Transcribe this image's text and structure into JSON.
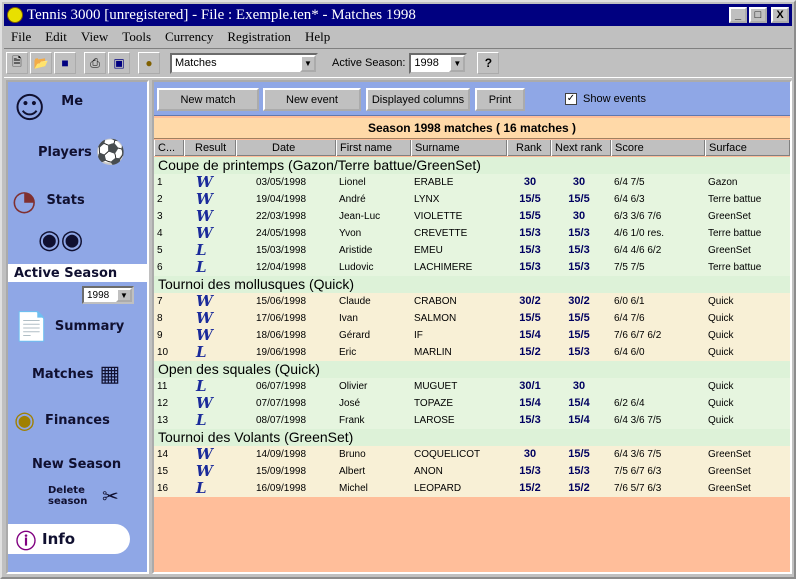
{
  "window": {
    "title": "Tennis 3000 [unregistered] - File : Exemple.ten* - Matches 1998",
    "buttons": [
      "_",
      "□",
      "X"
    ]
  },
  "menu": [
    "File",
    "Edit",
    "View",
    "Tools",
    "Currency",
    "Registration",
    "Help"
  ],
  "toolbar": {
    "view_select": "Matches",
    "season_label": "Active Season:",
    "season_select": "1998",
    "help_button": "?"
  },
  "sidebar": {
    "items": [
      "Me",
      "Players",
      "Stats",
      "Active Season",
      "Summary",
      "Matches",
      "Finances",
      "New Season",
      "Delete season",
      "Info"
    ],
    "season_select": "1998"
  },
  "actions": {
    "new_match": "New match",
    "new_event": "New event",
    "displayed_columns": "Displayed columns",
    "print": "Print",
    "show_events": "Show events",
    "show_events_checked": true
  },
  "season_header": "Season 1998 matches   ( 16 matches )",
  "columns": [
    "C...",
    "Result",
    "Date",
    "First name",
    "Surname",
    "Rank",
    "Next rank",
    "Score",
    "Surface"
  ],
  "groups": [
    {
      "title": "Coupe de printemps  (Gazon/Terre battue/GreenSet)",
      "bg": "green",
      "rows": [
        {
          "n": "1",
          "res": "W",
          "date": "03/05/1998",
          "first": "Lionel",
          "sur": "ERABLE",
          "rank": "30",
          "next": "30",
          "score": "6/4 7/5",
          "surface": "Gazon"
        },
        {
          "n": "2",
          "res": "W",
          "date": "19/04/1998",
          "first": "André",
          "sur": "LYNX",
          "rank": "15/5",
          "next": "15/5",
          "score": "6/4 6/3",
          "surface": "Terre battue"
        },
        {
          "n": "3",
          "res": "W",
          "date": "22/03/1998",
          "first": "Jean-Luc",
          "sur": "VIOLETTE",
          "rank": "15/5",
          "next": "30",
          "score": "6/3 3/6 7/6",
          "surface": "GreenSet"
        },
        {
          "n": "4",
          "res": "W",
          "date": "24/05/1998",
          "first": "Yvon",
          "sur": "CREVETTE",
          "rank": "15/3",
          "next": "15/3",
          "score": "4/6 1/0 res.",
          "surface": "Terre battue"
        },
        {
          "n": "5",
          "res": "L",
          "date": "15/03/1998",
          "first": "Aristide",
          "sur": "EMEU",
          "rank": "15/3",
          "next": "15/3",
          "score": "6/4 4/6 6/2",
          "surface": "GreenSet"
        },
        {
          "n": "6",
          "res": "L",
          "date": "12/04/1998",
          "first": "Ludovic",
          "sur": "LACHIMERE",
          "rank": "15/3",
          "next": "15/3",
          "score": "7/5 7/5",
          "surface": "Terre battue"
        }
      ]
    },
    {
      "title": "Tournoi des mollusques  (Quick)",
      "bg": "tan",
      "rows": [
        {
          "n": "7",
          "res": "W",
          "date": "15/06/1998",
          "first": "Claude",
          "sur": "CRABON",
          "rank": "30/2",
          "next": "30/2",
          "score": "6/0 6/1",
          "surface": "Quick"
        },
        {
          "n": "8",
          "res": "W",
          "date": "17/06/1998",
          "first": "Ivan",
          "sur": "SALMON",
          "rank": "15/5",
          "next": "15/5",
          "score": "6/4 7/6",
          "surface": "Quick"
        },
        {
          "n": "9",
          "res": "W",
          "date": "18/06/1998",
          "first": "Gérard",
          "sur": "IF",
          "rank": "15/4",
          "next": "15/5",
          "score": "7/6 6/7 6/2",
          "surface": "Quick"
        },
        {
          "n": "10",
          "res": "L",
          "date": "19/06/1998",
          "first": "Eric",
          "sur": "MARLIN",
          "rank": "15/2",
          "next": "15/3",
          "score": "6/4 6/0",
          "surface": "Quick"
        }
      ]
    },
    {
      "title": "Open des squales  (Quick)",
      "bg": "green",
      "rows": [
        {
          "n": "11",
          "res": "L",
          "date": "06/07/1998",
          "first": "Olivier",
          "sur": "MUGUET",
          "rank": "30/1",
          "next": "30",
          "score": "",
          "surface": "Quick"
        },
        {
          "n": "12",
          "res": "W",
          "date": "07/07/1998",
          "first": "José",
          "sur": "TOPAZE",
          "rank": "15/4",
          "next": "15/4",
          "score": "6/2 6/4",
          "surface": "Quick"
        },
        {
          "n": "13",
          "res": "L",
          "date": "08/07/1998",
          "first": "Frank",
          "sur": "LAROSE",
          "rank": "15/3",
          "next": "15/4",
          "score": "6/4 3/6 7/5",
          "surface": "Quick"
        }
      ]
    },
    {
      "title": "Tournoi des Volants  (GreenSet)",
      "bg": "tan",
      "rows": [
        {
          "n": "14",
          "res": "W",
          "date": "14/09/1998",
          "first": "Bruno",
          "sur": "COQUELICOT",
          "rank": "30",
          "next": "15/5",
          "score": "6/4 3/6 7/5",
          "surface": "GreenSet"
        },
        {
          "n": "15",
          "res": "W",
          "date": "15/09/1998",
          "first": "Albert",
          "sur": "ANON",
          "rank": "15/3",
          "next": "15/3",
          "score": "7/5 6/7 6/3",
          "surface": "GreenSet"
        },
        {
          "n": "16",
          "res": "L",
          "date": "16/09/1998",
          "first": "Michel",
          "sur": "LEOPARD",
          "rank": "15/2",
          "next": "15/2",
          "score": "7/6 5/7 6/3",
          "surface": "GreenSet"
        }
      ]
    }
  ]
}
